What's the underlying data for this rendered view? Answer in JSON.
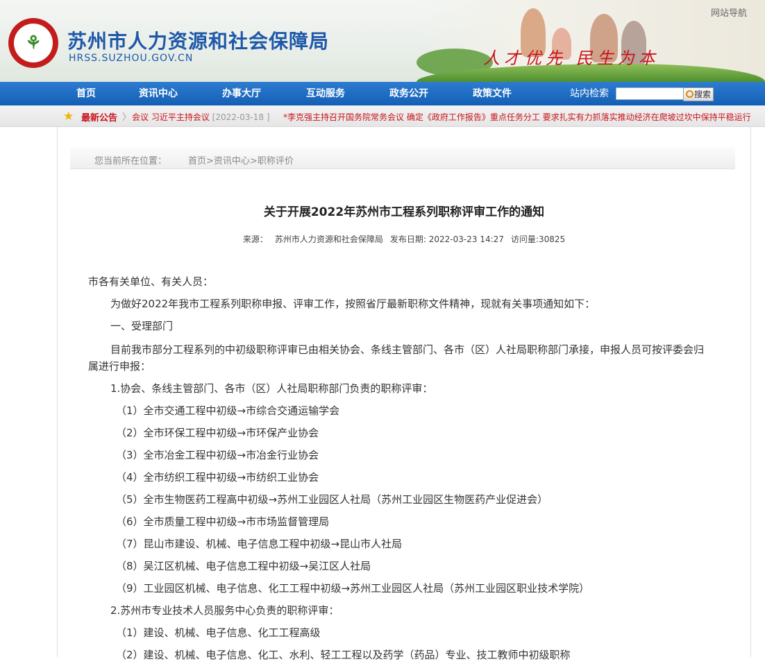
{
  "header": {
    "site_title": "苏州市人力资源和社会保障局",
    "site_domain": "HRSS.SUZHOU.GOV.CN",
    "nav_guide": "网站导航",
    "slogan": "人才优先 民生为本"
  },
  "nav": {
    "items": [
      "首页",
      "资讯中心",
      "办事大厅",
      "互动服务",
      "政务公开",
      "政策文件"
    ],
    "search_label": "站内检索",
    "search_value": "",
    "search_button": "搜索"
  },
  "notice": {
    "label": "最新公告",
    "item1_text": "会议 习近平主持会议",
    "item1_date": "[2022-03-18 ]",
    "item2_text": "*李克强主持召开国务院常务会议 确定《政府工作报告》重点任务分工 要求扎实有力抓落实推动经济在爬坡过坎中保持平稳运行"
  },
  "breadcrumb": {
    "prefix": "您当前所在位置：",
    "items": [
      "首页",
      "资讯中心",
      "职称评价"
    ],
    "separator": ">"
  },
  "article": {
    "title": "关于开展2022年苏州市工程系列职称评审工作的通知",
    "source_label": "来源：",
    "source": "苏州市人力资源和社会保障局",
    "date_label": "发布日期:",
    "date": "2022-03-23 14:27",
    "views_label": "访问量:",
    "views": "30825",
    "paragraphs": [
      "市各有关单位、有关人员：",
      "为做好2022年我市工程系列职称申报、评审工作，按照省厅最新职称文件精神，现就有关事项通知如下：",
      "一、受理部门",
      "目前我市部分工程系列的中初级职称评审已由相关协会、条线主管部门、各市（区）人社局职称部门承接，申报人员可按评委会归属进行申报：",
      "1.协会、条线主管部门、各市（区）人社局职称部门负责的职称评审：",
      "（1）全市交通工程中初级→市综合交通运输学会",
      "（2）全市环保工程中初级→市环保产业协会",
      "（3）全市冶金工程中初级→市冶金行业协会",
      "（4）全市纺织工程中初级→市纺织工业协会",
      "（5）全市生物医药工程高中初级→苏州工业园区人社局（苏州工业园区生物医药产业促进会）",
      "（6）全市质量工程中初级→市市场监督管理局",
      "（7）昆山市建设、机械、电子信息工程中初级→昆山市人社局",
      "（8）吴江区机械、电子信息工程中初级→吴江区人社局",
      "（9）工业园区机械、电子信息、化工工程中初级→苏州工业园区人社局（苏州工业园区职业技术学院）",
      "2.苏州市专业技术人员服务中心负责的职称评审：",
      "（1）建设、机械、电子信息、化工工程高级",
      "（2）建设、机械、电子信息、化工、水利、轻工工程以及药学（药品）专业、技工教师中初级职称"
    ]
  },
  "colors": {
    "brand_blue": "#1d58a8",
    "nav_blue": "#135fb5",
    "alert_red": "#c8141c"
  }
}
